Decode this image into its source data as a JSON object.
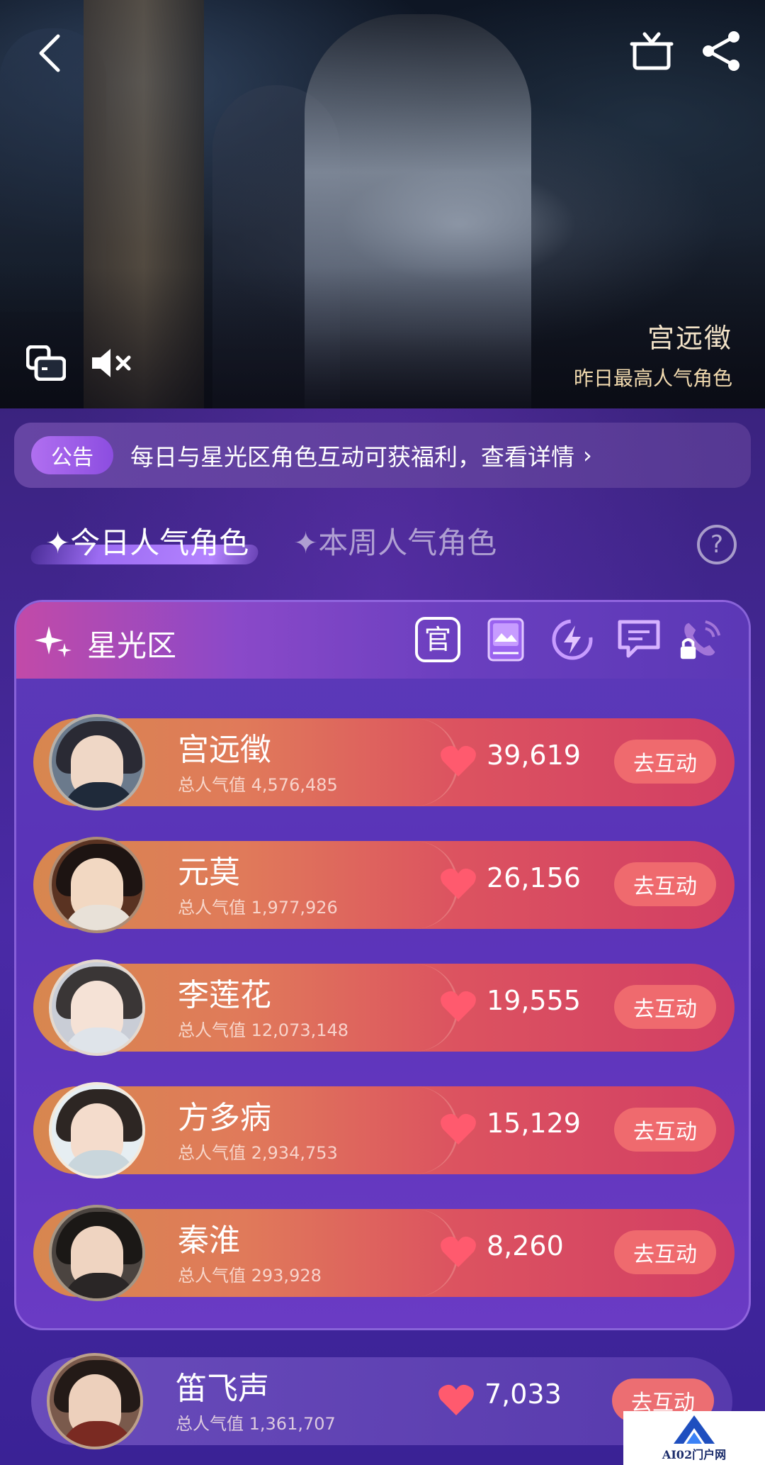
{
  "hero": {
    "character_name": "宫远徵",
    "subtitle": "昨日最高人气角色"
  },
  "notice": {
    "tag": "公告",
    "text": "每日与星光区角色互动可获福利，查看详情",
    "arrow": "›"
  },
  "tabs": [
    {
      "label": "✦今日人气角色",
      "active": true
    },
    {
      "label": "✦本周人气角色",
      "active": false
    }
  ],
  "help_symbol": "?",
  "zone": {
    "title": "星光区",
    "official_label": "官"
  },
  "rows": [
    {
      "name": "宫远徵",
      "popularity": "总人气值 4,576,485",
      "count": "39,619",
      "cta": "去互动"
    },
    {
      "name": "元莫",
      "popularity": "总人气值 1,977,926",
      "count": "26,156",
      "cta": "去互动"
    },
    {
      "name": "李莲花",
      "popularity": "总人气值 12,073,148",
      "count": "19,555",
      "cta": "去互动"
    },
    {
      "name": "方多病",
      "popularity": "总人气值 2,934,753",
      "count": "15,129",
      "cta": "去互动"
    },
    {
      "name": "秦淮",
      "popularity": "总人气值 293,928",
      "count": "8,260",
      "cta": "去互动"
    },
    {
      "name": "笛飞声",
      "popularity": "总人气值 1,361,707",
      "count": "7,033",
      "cta": "去互动"
    }
  ],
  "watermark": {
    "text": "AI02门户网"
  },
  "colors": {
    "accent": "#9c6cf2",
    "row_start": "#d7874f",
    "row_end": "#d23e64",
    "cta": "#ef6a6e",
    "heart": "#ff5a6e"
  },
  "icons": [
    "back-arrow-icon",
    "gift-icon",
    "share-icon",
    "screen-icon",
    "mute-icon",
    "sparkle-icon",
    "official-icon",
    "book-icon",
    "bolt-icon",
    "chat-icon",
    "call-locked-icon",
    "heart-icon",
    "help-icon"
  ]
}
